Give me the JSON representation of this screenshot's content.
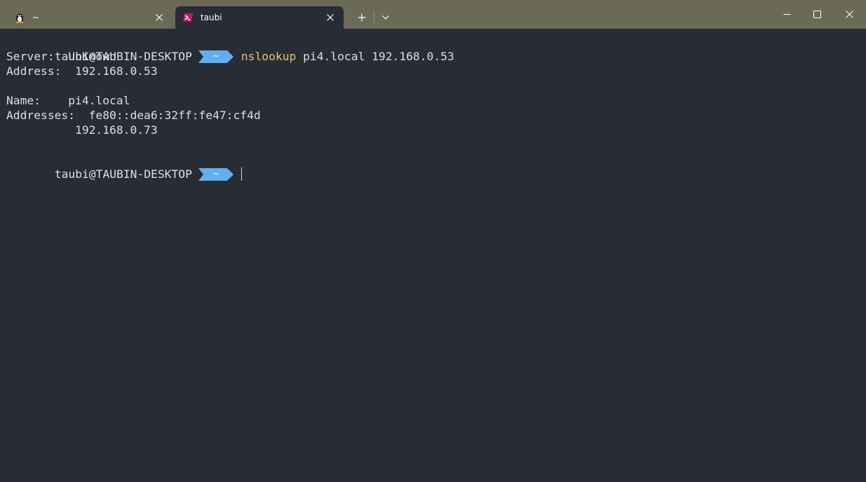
{
  "window": {
    "colors": {
      "titlebar": "#6b6a57",
      "terminal_bg": "#282c34",
      "prompt_segment": "#61afef",
      "command_text": "#e5c07b",
      "output_text": "#dcdfe4"
    }
  },
  "tabs": [
    {
      "title": "~",
      "icon": "linux-penguin-icon",
      "active": false
    },
    {
      "title": "taubi",
      "icon": "powershell-icon",
      "active": true
    }
  ],
  "titlebar_buttons": {
    "new_tab": "+",
    "dropdown": "chevron-down-icon",
    "minimize": "minimize-icon",
    "maximize": "maximize-icon",
    "close": "close-icon"
  },
  "terminal": {
    "prompt_user": "taubi@TAUBIN-DESKTOP",
    "prompt_dir": "~",
    "command": "nslookup",
    "command_args": " pi4.local 192.168.0.53",
    "output": [
      "Server:  UnKnown",
      "Address:  192.168.0.53",
      "",
      "Name:    pi4.local",
      "Addresses:  fe80::dea6:32ff:fe47:cf4d",
      "          192.168.0.73"
    ]
  }
}
